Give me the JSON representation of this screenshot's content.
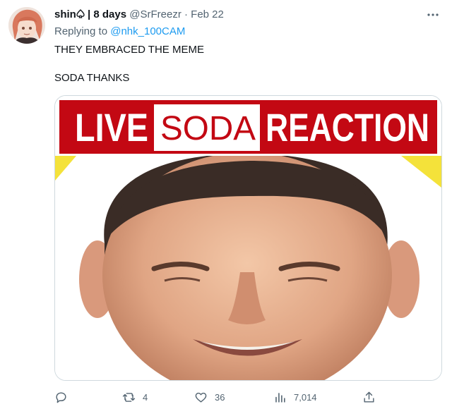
{
  "tweet": {
    "display_name": "shin",
    "badge_sep": " | 8 days",
    "handle": "@SrFreezr",
    "date": "· Feb 22",
    "replying_label": "Replying to",
    "replying_handle": "@nhk_100CAM",
    "text_line1": "THEY EMBRACED THE MEME",
    "text_line2": "SODA THANKS"
  },
  "media": {
    "banner_live": "LIVE",
    "banner_soda": "SODA",
    "banner_reaction": "REACTION"
  },
  "actions": {
    "reply_count": "",
    "retweet_count": "4",
    "like_count": "36",
    "views_count": "7,014"
  },
  "colors": {
    "banner_red": "#c30813",
    "link_blue": "#1d9bf0",
    "muted_gray": "#536471"
  },
  "icons": [
    "avatar-image",
    "spade-icon",
    "more-icon",
    "reply-icon",
    "retweet-icon",
    "like-icon",
    "views-icon",
    "share-icon"
  ]
}
